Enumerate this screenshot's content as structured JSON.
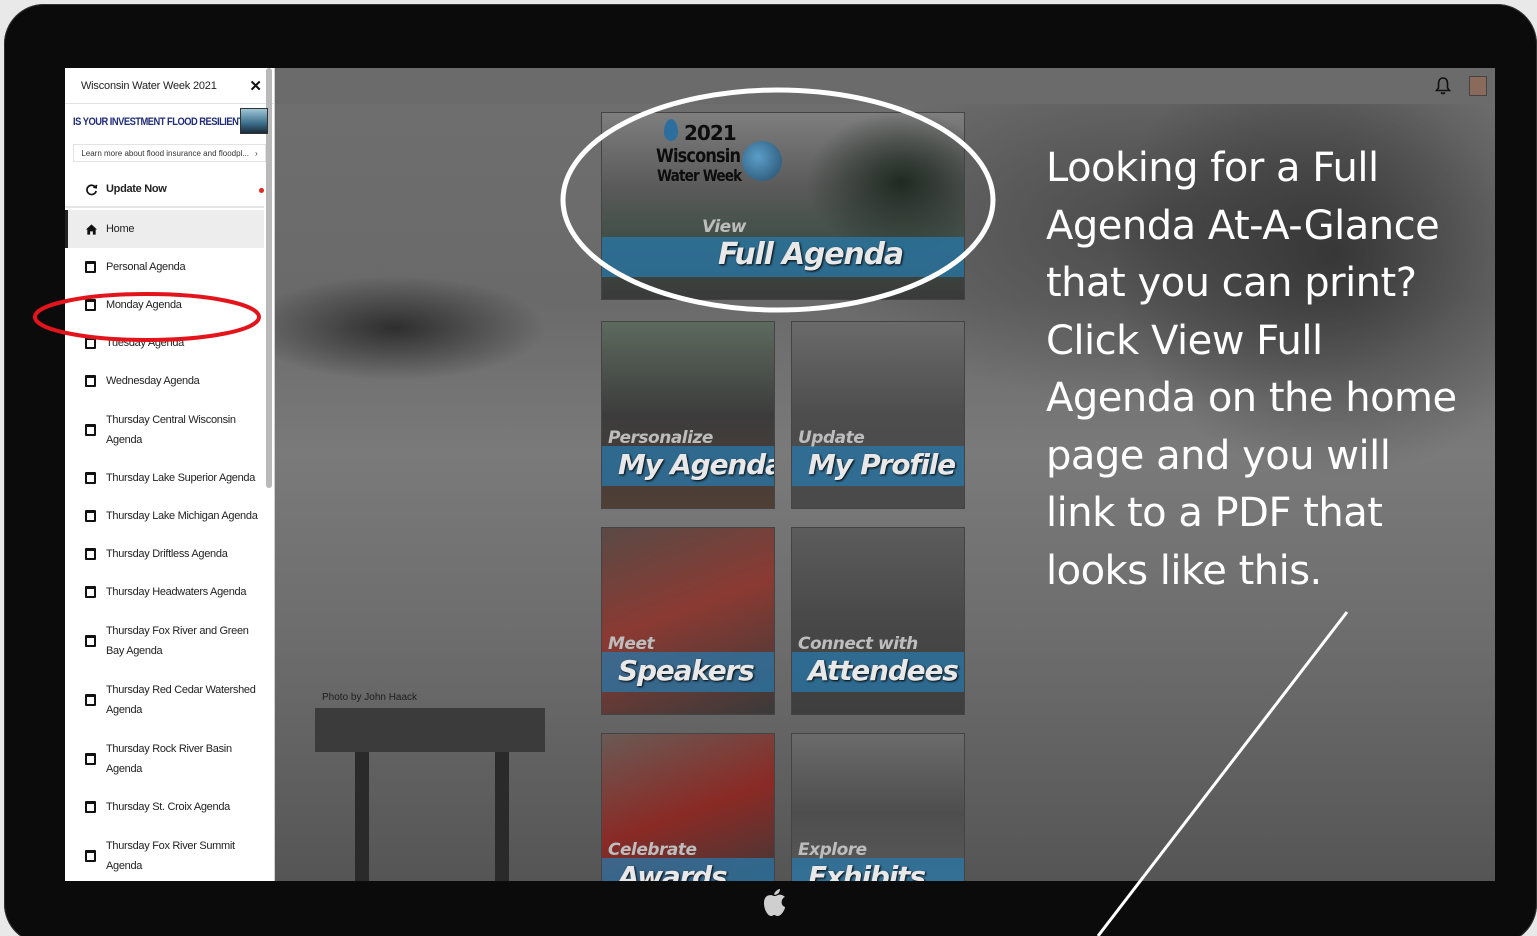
{
  "sidebar": {
    "title": "Wisconsin Water Week 2021",
    "close_icon": "close-icon",
    "banner": {
      "headline": "IS YOUR INVESTMENT FLOOD RESILIENT?",
      "link_text": "Learn more about flood insurance and floodpl...",
      "chevron": "›"
    },
    "update_label": "Update Now",
    "home_label": "Home",
    "items": [
      {
        "label": "Personal Agenda",
        "lines": 1
      },
      {
        "label": "Monday Agenda",
        "lines": 1
      },
      {
        "label": "Tuesday Agenda",
        "lines": 1
      },
      {
        "label": "Wednesday Agenda",
        "lines": 1
      },
      {
        "label": "Thursday Central Wisconsin Agenda",
        "lines": 2
      },
      {
        "label": "Thursday Lake Superior Agenda",
        "lines": 1
      },
      {
        "label": "Thursday Lake Michigan Agenda",
        "lines": 1
      },
      {
        "label": "Thursday Driftless Agenda",
        "lines": 1
      },
      {
        "label": "Thursday Headwaters Agenda",
        "lines": 1
      },
      {
        "label": "Thursday Fox River and Green Bay Agenda",
        "lines": 2
      },
      {
        "label": "Thursday Red Cedar Watershed Agenda",
        "lines": 2
      },
      {
        "label": "Thursday Rock River Basin Agenda",
        "lines": 2
      },
      {
        "label": "Thursday St. Croix Agenda",
        "lines": 1
      },
      {
        "label": "Thursday Fox River Summit Agenda",
        "lines": 2
      }
    ]
  },
  "main": {
    "photo_credit": "Photo by John Haack",
    "hero": {
      "logo_year": "2021",
      "logo_line1": "Wisconsin",
      "logo_line2": "Water Week",
      "small": "View",
      "big": "Full Agenda"
    },
    "tiles": [
      {
        "small": "Personalize",
        "big": "My Agenda"
      },
      {
        "small": "Update",
        "big": "My Profile"
      },
      {
        "small": "Meet",
        "big": "Speakers"
      },
      {
        "small": "Connect with",
        "big": "Attendees"
      },
      {
        "small": "Celebrate",
        "big": "Awards"
      },
      {
        "small": "Explore",
        "big": "Exhibits"
      }
    ]
  },
  "annotation": {
    "text": "Looking for a Full Agenda At-A-Glance that you can print? Click View Full Agenda on the home page and you will link to a PDF that looks like this.",
    "highlight_color": "#e3141b",
    "circle_color": "#ffffff"
  }
}
